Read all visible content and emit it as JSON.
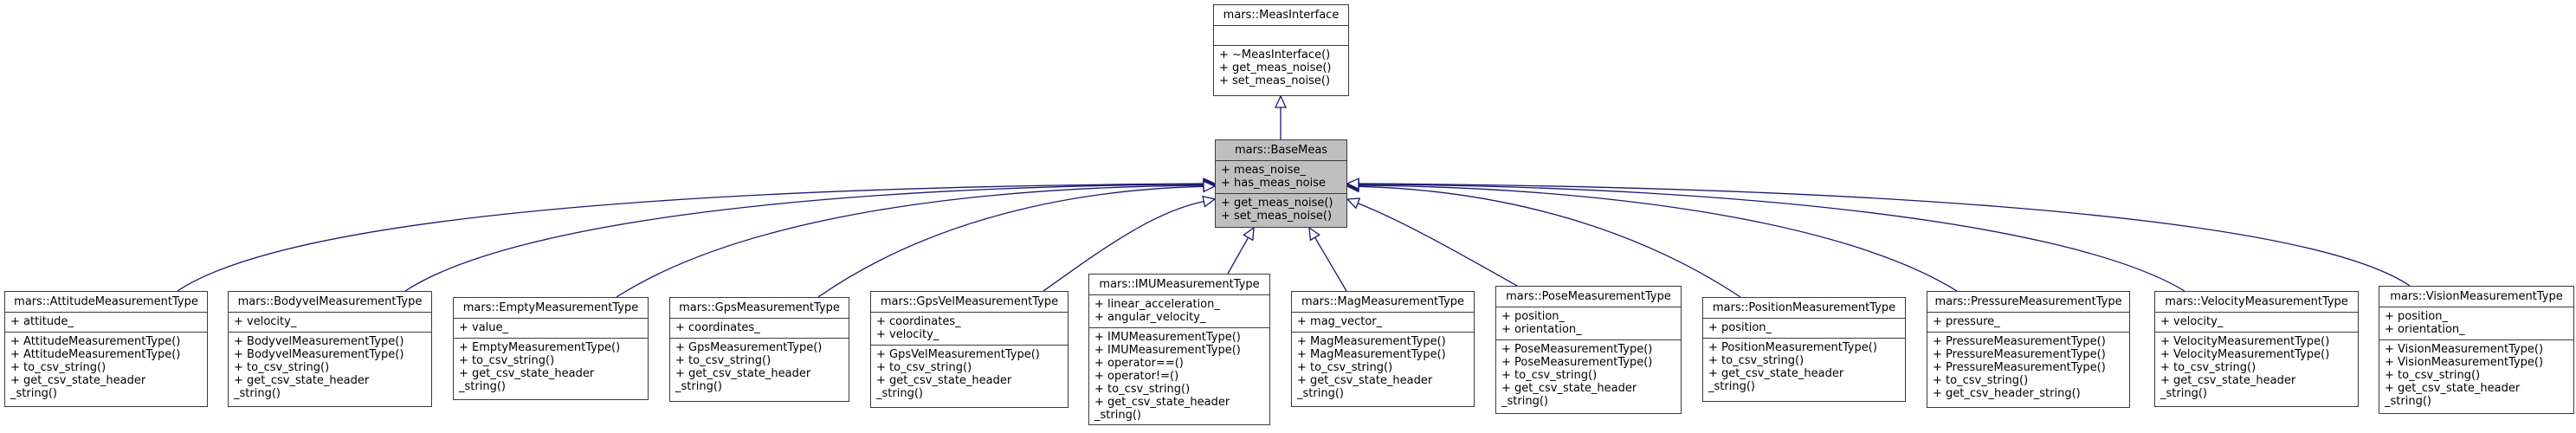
{
  "diagram": {
    "type": "doxygen-inheritance-graph",
    "edge_color": "#191970",
    "focus_fill": "#bfbfbf",
    "classes": [
      {
        "id": "meas-interface",
        "name": "mars::MeasInterface",
        "attributes": [],
        "operations": [
          "+ ~MeasInterface()",
          "+ get_meas_noise()",
          "+ set_meas_noise()"
        ]
      },
      {
        "id": "base-meas",
        "name": "mars::BaseMeas",
        "focus": true,
        "attributes": [
          "+ meas_noise_",
          "+ has_meas_noise"
        ],
        "operations": [
          "+ get_meas_noise()",
          "+ set_meas_noise()"
        ]
      },
      {
        "id": "attitude-measurement-type",
        "name": "mars::AttitudeMeasurementType",
        "attributes": [
          "+ attitude_"
        ],
        "operations": [
          "+ AttitudeMeasurementType()",
          "+ AttitudeMeasurementType()",
          "+ to_csv_string()",
          "+ get_csv_state_header",
          "_string()"
        ]
      },
      {
        "id": "bodyvel-measurement-type",
        "name": "mars::BodyvelMeasurementType",
        "attributes": [
          "+ velocity_"
        ],
        "operations": [
          "+ BodyvelMeasurementType()",
          "+ BodyvelMeasurementType()",
          "+ to_csv_string()",
          "+ get_csv_state_header",
          "_string()"
        ]
      },
      {
        "id": "empty-measurement-type",
        "name": "mars::EmptyMeasurementType",
        "attributes": [
          "+ value_"
        ],
        "operations": [
          "+ EmptyMeasurementType()",
          "+ to_csv_string()",
          "+ get_csv_state_header",
          "_string()"
        ]
      },
      {
        "id": "gps-measurement-type",
        "name": "mars::GpsMeasurementType",
        "attributes": [
          "+ coordinates_"
        ],
        "operations": [
          "+ GpsMeasurementType()",
          "+ to_csv_string()",
          "+ get_csv_state_header",
          "_string()"
        ]
      },
      {
        "id": "gpsvel-measurement-type",
        "name": "mars::GpsVelMeasurementType",
        "attributes": [
          "+ coordinates_",
          "+ velocity_"
        ],
        "operations": [
          "+ GpsVelMeasurementType()",
          "+ to_csv_string()",
          "+ get_csv_state_header",
          "_string()"
        ]
      },
      {
        "id": "imu-measurement-type",
        "name": "mars::IMUMeasurementType",
        "attributes": [
          "+ linear_acceleration_",
          "+ angular_velocity_"
        ],
        "operations": [
          "+ IMUMeasurementType()",
          "+ IMUMeasurementType()",
          "+ operator==()",
          "+ operator!=()",
          "+ to_csv_string()",
          "+ get_csv_state_header",
          "_string()"
        ]
      },
      {
        "id": "mag-measurement-type",
        "name": "mars::MagMeasurementType",
        "attributes": [
          "+ mag_vector_"
        ],
        "operations": [
          "+ MagMeasurementType()",
          "+ MagMeasurementType()",
          "+ to_csv_string()",
          "+ get_csv_state_header",
          "_string()"
        ]
      },
      {
        "id": "pose-measurement-type",
        "name": "mars::PoseMeasurementType",
        "attributes": [
          "+ position_",
          "+ orientation_"
        ],
        "operations": [
          "+ PoseMeasurementType()",
          "+ PoseMeasurementType()",
          "+ to_csv_string()",
          "+ get_csv_state_header",
          "_string()"
        ]
      },
      {
        "id": "position-measurement-type",
        "name": "mars::PositionMeasurementType",
        "attributes": [
          "+ position_"
        ],
        "operations": [
          "+ PositionMeasurementType()",
          "+ to_csv_string()",
          "+ get_csv_state_header",
          "_string()"
        ]
      },
      {
        "id": "pressure-measurement-type",
        "name": "mars::PressureMeasurementType",
        "attributes": [
          "+ pressure_"
        ],
        "operations": [
          "+ PressureMeasurementType()",
          "+ PressureMeasurementType()",
          "+ PressureMeasurementType()",
          "+ to_csv_string()",
          "+ get_csv_header_string()"
        ]
      },
      {
        "id": "velocity-measurement-type",
        "name": "mars::VelocityMeasurementType",
        "attributes": [
          "+ velocity_"
        ],
        "operations": [
          "+ VelocityMeasurementType()",
          "+ VelocityMeasurementType()",
          "+ to_csv_string()",
          "+ get_csv_state_header",
          "_string()"
        ]
      },
      {
        "id": "vision-measurement-type",
        "name": "mars::VisionMeasurementType",
        "attributes": [
          "+ position_",
          "+ orientation_"
        ],
        "operations": [
          "+ VisionMeasurementType()",
          "+ VisionMeasurementType()",
          "+ to_csv_string()",
          "+ get_csv_state_header",
          "_string()"
        ]
      }
    ],
    "edges": [
      {
        "from": "base-meas",
        "to": "meas-interface",
        "relation": "inherits"
      },
      {
        "from": "attitude-measurement-type",
        "to": "base-meas",
        "relation": "inherits"
      },
      {
        "from": "bodyvel-measurement-type",
        "to": "base-meas",
        "relation": "inherits"
      },
      {
        "from": "empty-measurement-type",
        "to": "base-meas",
        "relation": "inherits"
      },
      {
        "from": "gps-measurement-type",
        "to": "base-meas",
        "relation": "inherits"
      },
      {
        "from": "gpsvel-measurement-type",
        "to": "base-meas",
        "relation": "inherits"
      },
      {
        "from": "imu-measurement-type",
        "to": "base-meas",
        "relation": "inherits"
      },
      {
        "from": "mag-measurement-type",
        "to": "base-meas",
        "relation": "inherits"
      },
      {
        "from": "pose-measurement-type",
        "to": "base-meas",
        "relation": "inherits"
      },
      {
        "from": "position-measurement-type",
        "to": "base-meas",
        "relation": "inherits"
      },
      {
        "from": "pressure-measurement-type",
        "to": "base-meas",
        "relation": "inherits"
      },
      {
        "from": "velocity-measurement-type",
        "to": "base-meas",
        "relation": "inherits"
      },
      {
        "from": "vision-measurement-type",
        "to": "base-meas",
        "relation": "inherits"
      }
    ]
  }
}
